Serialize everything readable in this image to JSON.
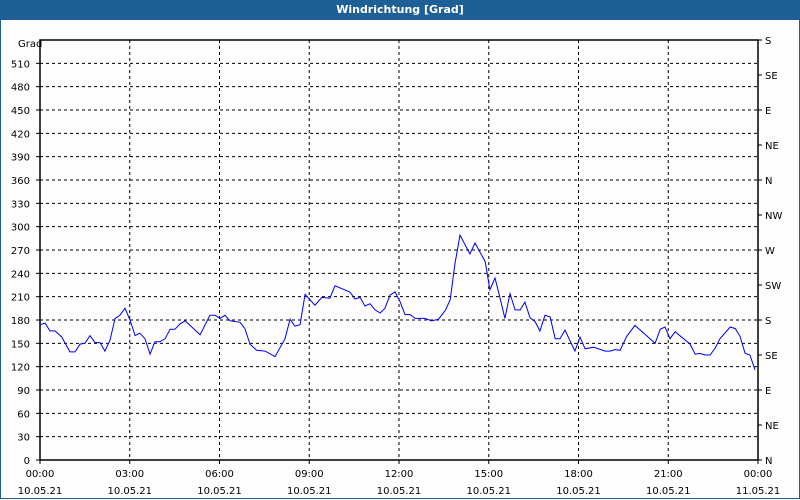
{
  "window": {
    "title": "Windrichtung [Grad]"
  },
  "chart_data": {
    "type": "line",
    "title": "Windrichtung [Grad]",
    "ylabel": "Grad",
    "ylim": [
      0,
      540
    ],
    "xlim_hours": [
      0,
      24
    ],
    "grid": true,
    "y_ticks": [
      0,
      30,
      60,
      90,
      120,
      150,
      180,
      210,
      240,
      270,
      300,
      330,
      360,
      390,
      420,
      450,
      480,
      510
    ],
    "right_ticks": [
      {
        "value": 0,
        "label": "N"
      },
      {
        "value": 45,
        "label": "NE"
      },
      {
        "value": 90,
        "label": "E"
      },
      {
        "value": 135,
        "label": "SE"
      },
      {
        "value": 180,
        "label": "S"
      },
      {
        "value": 225,
        "label": "SW"
      },
      {
        "value": 270,
        "label": "W"
      },
      {
        "value": 315,
        "label": "NW"
      },
      {
        "value": 360,
        "label": "N"
      },
      {
        "value": 405,
        "label": "NE"
      },
      {
        "value": 450,
        "label": "E"
      },
      {
        "value": 495,
        "label": "SE"
      },
      {
        "value": 540,
        "label": "S"
      }
    ],
    "x_ticks": [
      {
        "hour": 0,
        "time": "00:00",
        "date": "10.05.21"
      },
      {
        "hour": 3,
        "time": "03:00",
        "date": "10.05.21"
      },
      {
        "hour": 6,
        "time": "06:00",
        "date": "10.05.21"
      },
      {
        "hour": 9,
        "time": "09:00",
        "date": "10.05.21"
      },
      {
        "hour": 12,
        "time": "12:00",
        "date": "10.05.21"
      },
      {
        "hour": 15,
        "time": "15:00",
        "date": "10.05.21"
      },
      {
        "hour": 18,
        "time": "18:00",
        "date": "10.05.21"
      },
      {
        "hour": 21,
        "time": "21:00",
        "date": "10.05.21"
      },
      {
        "hour": 24,
        "time": "00:00",
        "date": "11.05.21"
      }
    ],
    "series": [
      {
        "name": "Windrichtung",
        "color": "#0000ee",
        "x": [
          0,
          0.17,
          0.33,
          0.5,
          0.73,
          1.0,
          1.17,
          1.34,
          1.5,
          1.67,
          1.84,
          2.01,
          2.17,
          2.34,
          2.51,
          2.67,
          2.84,
          3.01,
          3.18,
          3.34,
          3.51,
          3.68,
          3.84,
          4.01,
          4.18,
          4.35,
          4.51,
          4.68,
          4.85,
          5.35,
          5.68,
          5.85,
          6.02,
          6.18,
          6.35,
          6.69,
          6.85,
          7.02,
          7.24,
          7.52,
          7.86,
          8.19,
          8.36,
          8.52,
          8.69,
          8.86,
          9.19,
          9.42,
          9.69,
          9.86,
          10.36,
          10.53,
          10.7,
          10.86,
          11.03,
          11.2,
          11.37,
          11.53,
          11.7,
          11.87,
          12.03,
          12.2,
          12.37,
          12.54,
          12.87,
          13.09,
          13.32,
          13.54,
          13.71,
          13.87,
          14.04,
          14.37,
          14.54,
          14.88,
          15.04,
          15.21,
          15.38,
          15.54,
          15.71,
          15.88,
          16.05,
          16.21,
          16.38,
          16.55,
          16.71,
          16.88,
          17.05,
          17.22,
          17.38,
          17.55,
          17.88,
          18.05,
          18.22,
          18.5,
          18.89,
          19.06,
          19.22,
          19.39,
          19.61,
          19.89,
          20.56,
          20.73,
          20.89,
          21.06,
          21.23,
          21.73,
          21.9,
          22.06,
          22.23,
          22.4,
          22.57,
          22.73,
          23.07,
          23.24,
          23.4,
          23.57,
          23.73,
          23.9
        ],
        "y": [
          174,
          176,
          166,
          166,
          158,
          139,
          139,
          149,
          150,
          160,
          151,
          151,
          140,
          154,
          182,
          186,
          195,
          180,
          160,
          163,
          156,
          136,
          152,
          152,
          156,
          168,
          168,
          175,
          179,
          161,
          186,
          186,
          182,
          186,
          179,
          177,
          169,
          149,
          141,
          140,
          133,
          156,
          181,
          172,
          174,
          213,
          199,
          209,
          208,
          224,
          216,
          207,
          209,
          198,
          201,
          193,
          189,
          195,
          212,
          216,
          204,
          187,
          187,
          182,
          182,
          179,
          181,
          192,
          206,
          252,
          289,
          265,
          279,
          255,
          219,
          234,
          208,
          182,
          214,
          193,
          193,
          203,
          183,
          178,
          166,
          186,
          184,
          156,
          156,
          167,
          140,
          158,
          143,
          145,
          140,
          140,
          142,
          141,
          159,
          173,
          150,
          168,
          171,
          156,
          165,
          149,
          136,
          137,
          135,
          135,
          144,
          156,
          171,
          169,
          159,
          137,
          135,
          116
        ]
      }
    ]
  }
}
